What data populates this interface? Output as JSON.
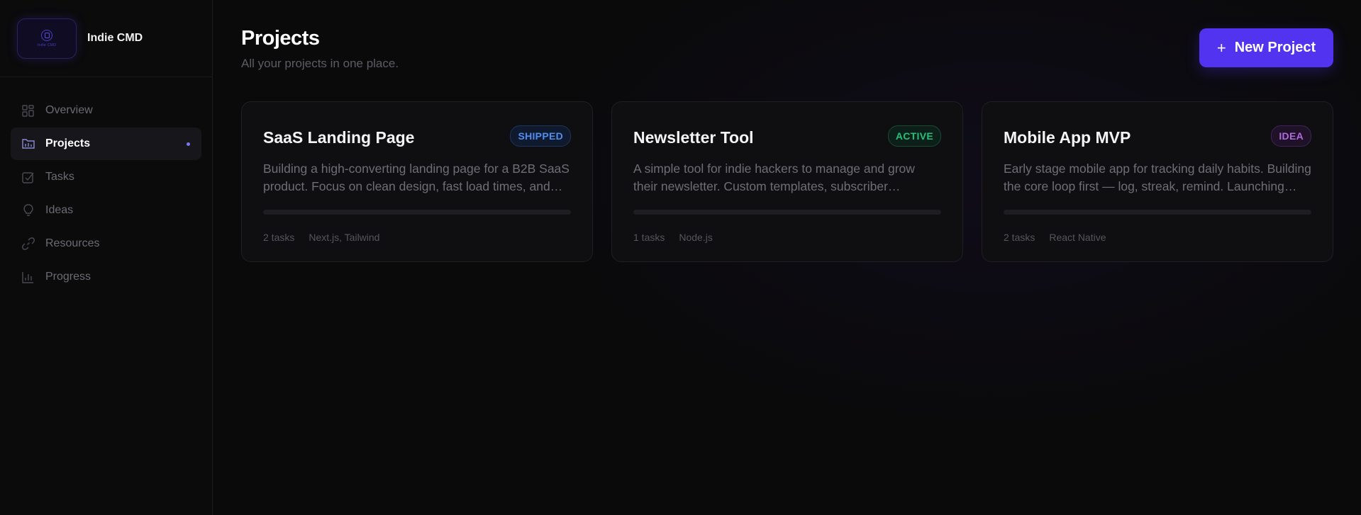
{
  "brand": {
    "name": "Indie CMD",
    "logo_text": "Indie CMD"
  },
  "nav": [
    {
      "label": "Overview",
      "icon": "grid-icon",
      "active": false
    },
    {
      "label": "Projects",
      "icon": "folder-icon",
      "active": true
    },
    {
      "label": "Tasks",
      "icon": "checkbox-icon",
      "active": false
    },
    {
      "label": "Ideas",
      "icon": "lightbulb-icon",
      "active": false
    },
    {
      "label": "Resources",
      "icon": "link-icon",
      "active": false
    },
    {
      "label": "Progress",
      "icon": "bar-chart-icon",
      "active": false
    }
  ],
  "header": {
    "title": "Projects",
    "subtitle": "All your projects in one place.",
    "new_button": "New Project"
  },
  "projects": [
    {
      "title": "SaaS Landing Page",
      "status": "SHIPPED",
      "description": "Building a high-converting landing page for a B2B SaaS product. Focus on clean design, fast load times, and…",
      "progress": 0,
      "tasks": "2 tasks",
      "stack": "Next.js, Tailwind"
    },
    {
      "title": "Newsletter Tool",
      "status": "ACTIVE",
      "description": "A simple tool for indie hackers to manage and grow their newsletter. Custom templates, subscriber analytic…",
      "progress": 0,
      "tasks": "1 tasks",
      "stack": "Node.js"
    },
    {
      "title": "Mobile App MVP",
      "status": "IDEA",
      "description": "Early stage mobile app for tracking daily habits. Building the core loop first — log, streak, remind. Launching on…",
      "progress": 0,
      "tasks": "2 tasks",
      "stack": "React Native"
    }
  ],
  "colors": {
    "accent": "#5233f0",
    "shipped": "#4f8ef0",
    "active": "#22c07a",
    "idea": "#b06ae0"
  }
}
